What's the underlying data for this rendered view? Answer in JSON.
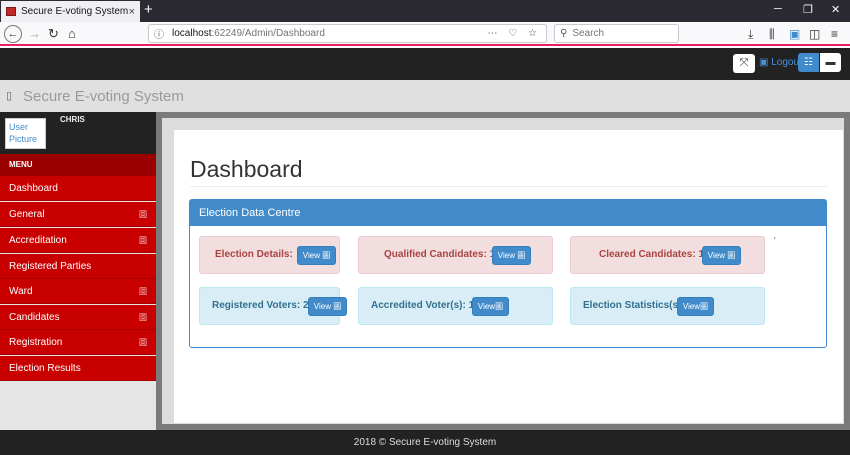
{
  "browser": {
    "tab_title": "Secure E-voting System",
    "tab_close": "×",
    "new_tab": "+",
    "url_host": "localhost",
    "url_path": ":62249/Admin/Dashboard",
    "search_placeholder": "Search",
    "win_min": "─",
    "win_max": "❐",
    "win_close": "✕"
  },
  "header": {
    "logout_label": "Logout",
    "brand": "Secure E-voting System"
  },
  "sidebar": {
    "user_picture": "User Picture",
    "username": "CHRIS",
    "menu_label": "MENU",
    "items": [
      {
        "label": "Dashboard",
        "has_submenu": false
      },
      {
        "label": "General",
        "has_submenu": true
      },
      {
        "label": "Accreditation",
        "has_submenu": true
      },
      {
        "label": "Registered Parties",
        "has_submenu": false
      },
      {
        "label": "Ward",
        "has_submenu": true
      },
      {
        "label": "Candidates",
        "has_submenu": true
      },
      {
        "label": "Registration",
        "has_submenu": true
      },
      {
        "label": "Election Results",
        "has_submenu": false
      }
    ]
  },
  "main": {
    "page_title": "Dashboard",
    "panel_title": "Election Data Centre",
    "panel_mark": "'",
    "cards": [
      {
        "label": "Election Details:",
        "button": "View 圖"
      },
      {
        "label": "Qualified Candidates: 16",
        "button": "View 圖"
      },
      {
        "label": "Cleared Candidates: 16",
        "button": "View 圖"
      },
      {
        "label": "Registered Voters: 21",
        "button": "View 圖"
      },
      {
        "label": "Accredited Voter(s): 16",
        "button": "View圖"
      },
      {
        "label": "Election Statistics(s):",
        "button": "View圖"
      }
    ]
  },
  "footer": {
    "text": "2018 © Secure E-voting System"
  },
  "colors": {
    "sidebar_red": "#c90000",
    "primary_blue": "#428bca",
    "danger_bg": "#f2dede",
    "info_bg": "#d9edf7"
  }
}
